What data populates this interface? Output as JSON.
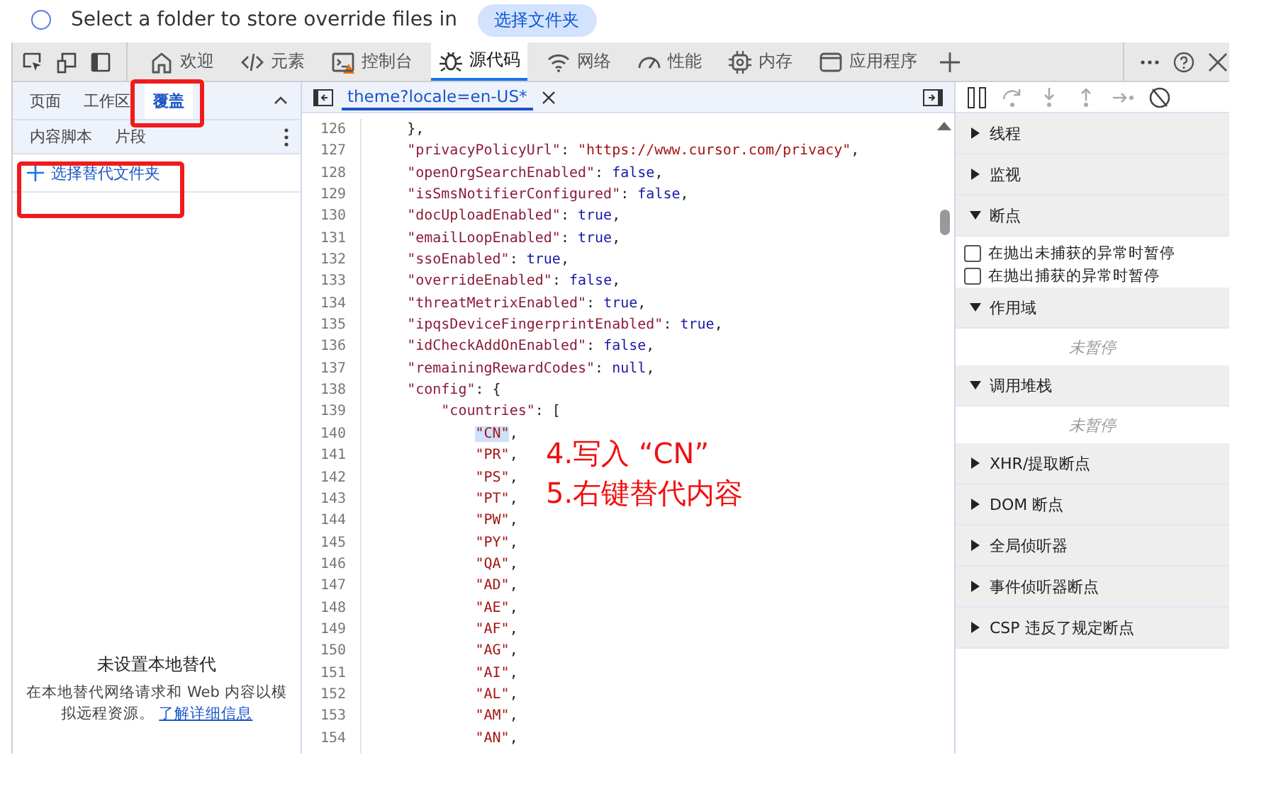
{
  "infobar": {
    "message": "Select a folder to store override files in",
    "button": "选择文件夹"
  },
  "toolbar": {
    "tabs": [
      {
        "label": "欢迎",
        "selected": false,
        "warning": false
      },
      {
        "label": "元素",
        "selected": false,
        "warning": false
      },
      {
        "label": "控制台",
        "selected": false,
        "warning": true
      },
      {
        "label": "源代码",
        "selected": true,
        "warning": false
      },
      {
        "label": "网络",
        "selected": false,
        "warning": false
      },
      {
        "label": "性能",
        "selected": false,
        "warning": false
      },
      {
        "label": "内存",
        "selected": false,
        "warning": false
      },
      {
        "label": "应用程序",
        "selected": false,
        "warning": false
      }
    ]
  },
  "navigator": {
    "tabs": [
      {
        "label": "页面",
        "selected": false
      },
      {
        "label": "工作区",
        "selected": false
      },
      {
        "label": "覆盖",
        "selected": true
      }
    ],
    "subtabs": [
      {
        "label": "内容脚本"
      },
      {
        "label": "片段"
      }
    ],
    "add_folder": "选择替代文件夹",
    "empty_title": "未设置本地替代",
    "empty_text": "在本地替代网络请求和 Web 内容以模拟远程资源。",
    "learn_more": "了解详细信息"
  },
  "editor": {
    "file_tab": "theme?locale=en-US*",
    "lines": [
      {
        "num": "126",
        "parts": [
          {
            "kind": "punc",
            "text": "    },"
          }
        ]
      },
      {
        "num": "127",
        "parts": [
          {
            "kind": "key",
            "text": "    \"privacyPolicyUrl\""
          },
          {
            "kind": "punc",
            "text": ": "
          },
          {
            "kind": "string",
            "text": "\"https://www.cursor.com/privacy\""
          },
          {
            "kind": "punc",
            "text": ","
          }
        ]
      },
      {
        "num": "128",
        "parts": [
          {
            "kind": "key",
            "text": "    \"openOrgSearchEnabled\""
          },
          {
            "kind": "punc",
            "text": ": "
          },
          {
            "kind": "literal",
            "text": "false"
          },
          {
            "kind": "punc",
            "text": ","
          }
        ]
      },
      {
        "num": "129",
        "parts": [
          {
            "kind": "key",
            "text": "    \"isSmsNotifierConfigured\""
          },
          {
            "kind": "punc",
            "text": ": "
          },
          {
            "kind": "literal",
            "text": "false"
          },
          {
            "kind": "punc",
            "text": ","
          }
        ]
      },
      {
        "num": "130",
        "parts": [
          {
            "kind": "key",
            "text": "    \"docUploadEnabled\""
          },
          {
            "kind": "punc",
            "text": ": "
          },
          {
            "kind": "literal",
            "text": "true"
          },
          {
            "kind": "punc",
            "text": ","
          }
        ]
      },
      {
        "num": "131",
        "parts": [
          {
            "kind": "key",
            "text": "    \"emailLoopEnabled\""
          },
          {
            "kind": "punc",
            "text": ": "
          },
          {
            "kind": "literal",
            "text": "true"
          },
          {
            "kind": "punc",
            "text": ","
          }
        ]
      },
      {
        "num": "132",
        "parts": [
          {
            "kind": "key",
            "text": "    \"ssoEnabled\""
          },
          {
            "kind": "punc",
            "text": ": "
          },
          {
            "kind": "literal",
            "text": "true"
          },
          {
            "kind": "punc",
            "text": ","
          }
        ]
      },
      {
        "num": "133",
        "parts": [
          {
            "kind": "key",
            "text": "    \"overrideEnabled\""
          },
          {
            "kind": "punc",
            "text": ": "
          },
          {
            "kind": "literal",
            "text": "false"
          },
          {
            "kind": "punc",
            "text": ","
          }
        ]
      },
      {
        "num": "134",
        "parts": [
          {
            "kind": "key",
            "text": "    \"threatMetrixEnabled\""
          },
          {
            "kind": "punc",
            "text": ": "
          },
          {
            "kind": "literal",
            "text": "true"
          },
          {
            "kind": "punc",
            "text": ","
          }
        ]
      },
      {
        "num": "135",
        "parts": [
          {
            "kind": "key",
            "text": "    \"ipqsDeviceFingerprintEnabled\""
          },
          {
            "kind": "punc",
            "text": ": "
          },
          {
            "kind": "literal",
            "text": "true"
          },
          {
            "kind": "punc",
            "text": ","
          }
        ]
      },
      {
        "num": "136",
        "parts": [
          {
            "kind": "key",
            "text": "    \"idCheckAddOnEnabled\""
          },
          {
            "kind": "punc",
            "text": ": "
          },
          {
            "kind": "literal",
            "text": "false"
          },
          {
            "kind": "punc",
            "text": ","
          }
        ]
      },
      {
        "num": "137",
        "parts": [
          {
            "kind": "key",
            "text": "    \"remainingRewardCodes\""
          },
          {
            "kind": "punc",
            "text": ": "
          },
          {
            "kind": "literal",
            "text": "null"
          },
          {
            "kind": "punc",
            "text": ","
          }
        ]
      },
      {
        "num": "138",
        "parts": [
          {
            "kind": "key",
            "text": "    \"config\""
          },
          {
            "kind": "punc",
            "text": ": {"
          }
        ]
      },
      {
        "num": "139",
        "parts": [
          {
            "kind": "key",
            "text": "        \"countries\""
          },
          {
            "kind": "punc",
            "text": ": ["
          }
        ]
      },
      {
        "num": "140",
        "parts": [
          {
            "kind": "string",
            "text": "\"CN\"",
            "highlighted": true
          },
          {
            "kind": "punc",
            "text": ","
          }
        ]
      },
      {
        "num": "141",
        "parts": [
          {
            "kind": "string",
            "text": "            \"PR\"",
            "highlighted": false
          },
          {
            "kind": "punc",
            "text": ","
          }
        ]
      },
      {
        "num": "142",
        "parts": [
          {
            "kind": "string",
            "text": "            \"PS\""
          },
          {
            "kind": "punc",
            "text": ","
          }
        ]
      },
      {
        "num": "143",
        "parts": [
          {
            "kind": "string",
            "text": "            \"PT\""
          },
          {
            "kind": "punc",
            "text": ","
          }
        ]
      },
      {
        "num": "144",
        "parts": [
          {
            "kind": "string",
            "text": "            \"PW\""
          },
          {
            "kind": "punc",
            "text": ","
          }
        ]
      },
      {
        "num": "145",
        "parts": [
          {
            "kind": "string",
            "text": "            \"PY\""
          },
          {
            "kind": "punc",
            "text": ","
          }
        ]
      },
      {
        "num": "146",
        "parts": [
          {
            "kind": "string",
            "text": "            \"QA\""
          },
          {
            "kind": "punc",
            "text": ","
          }
        ]
      },
      {
        "num": "147",
        "parts": [
          {
            "kind": "string",
            "text": "            \"AD\""
          },
          {
            "kind": "punc",
            "text": ","
          }
        ]
      },
      {
        "num": "148",
        "parts": [
          {
            "kind": "string",
            "text": "            \"AE\""
          },
          {
            "kind": "punc",
            "text": ","
          }
        ]
      },
      {
        "num": "149",
        "parts": [
          {
            "kind": "string",
            "text": "            \"AF\""
          },
          {
            "kind": "punc",
            "text": ","
          }
        ]
      },
      {
        "num": "150",
        "parts": [
          {
            "kind": "string",
            "text": "            \"AG\""
          },
          {
            "kind": "punc",
            "text": ","
          }
        ]
      },
      {
        "num": "151",
        "parts": [
          {
            "kind": "string",
            "text": "            \"AI\""
          },
          {
            "kind": "punc",
            "text": ","
          }
        ]
      },
      {
        "num": "152",
        "parts": [
          {
            "kind": "string",
            "text": "            \"AL\""
          },
          {
            "kind": "punc",
            "text": ","
          }
        ]
      },
      {
        "num": "153",
        "parts": [
          {
            "kind": "string",
            "text": "            \"AM\""
          },
          {
            "kind": "punc",
            "text": ","
          }
        ]
      },
      {
        "num": "154",
        "parts": [
          {
            "kind": "string",
            "text": "            \"AN\""
          },
          {
            "kind": "punc",
            "text": ","
          }
        ]
      }
    ]
  },
  "annotations": [
    "4.写入 “CN”",
    "5.右键替代内容"
  ],
  "debugger": {
    "sections": [
      {
        "kind": "section",
        "label": "线程",
        "expanded": false
      },
      {
        "kind": "section",
        "label": "监视",
        "expanded": false
      },
      {
        "kind": "section",
        "label": "断点",
        "expanded": true
      },
      {
        "kind": "checkbox",
        "label": "在抛出未捕获的异常时暂停",
        "checked": false
      },
      {
        "kind": "checkbox",
        "label": "在抛出捕获的异常时暂停",
        "checked": false
      },
      {
        "kind": "section",
        "label": "作用域",
        "expanded": true
      },
      {
        "kind": "note",
        "label": "未暂停"
      },
      {
        "kind": "section",
        "label": "调用堆栈",
        "expanded": true
      },
      {
        "kind": "note",
        "label": "未暂停"
      },
      {
        "kind": "section",
        "label": "XHR/提取断点",
        "expanded": false
      },
      {
        "kind": "section",
        "label": "DOM 断点",
        "expanded": false
      },
      {
        "kind": "section",
        "label": "全局侦听器",
        "expanded": false
      },
      {
        "kind": "section",
        "label": "事件侦听器断点",
        "expanded": false
      },
      {
        "kind": "section",
        "label": "CSP 违反了规定断点",
        "expanded": false
      }
    ]
  }
}
